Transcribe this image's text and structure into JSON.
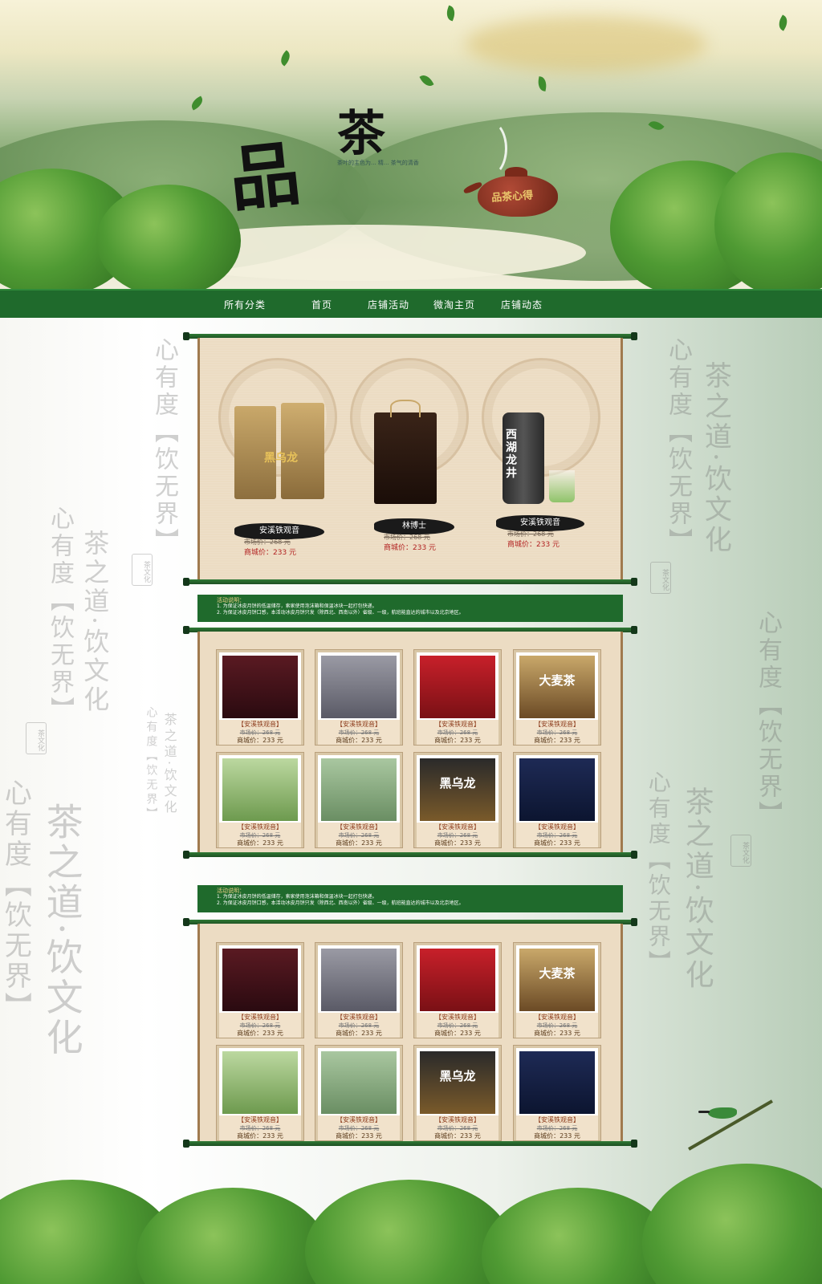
{
  "hero": {
    "logo_char_1": "品",
    "logo_char_2": "茶",
    "slogan": "茶叶的主色为... 精... 茶气的清香",
    "teapot_text": "品茶心得"
  },
  "nav": {
    "items": [
      "所有分类",
      "首页",
      "店铺活动",
      "微淘主页",
      "店铺动态"
    ]
  },
  "background_calligraphy": {
    "line_1": "心有度【饮无界】",
    "line_2": "茶之道·饮文化",
    "seal": "茶文化"
  },
  "featured": {
    "items": [
      {
        "name": "安溪铁观音",
        "market": "市场价：268 元",
        "price": "商城价：233 元",
        "img_label": "黑乌龙"
      },
      {
        "name": "林博士",
        "market": "市场价：268 元",
        "price": "商城价：233 元",
        "img_label": ""
      },
      {
        "name": "安溪铁观音",
        "market": "市场价：268 元",
        "price": "商城价：233 元",
        "img_label": "西湖龙井"
      }
    ]
  },
  "banners": [
    {
      "title": "活动说明：",
      "line1": "1. 为保证冰皮月饼的低温储存，索家使用泡沫箱和保温冰块一起打包快递。",
      "line2": "2. 为保证冰皮月饼口感，本活动冰皮月饼只发（除西北、西南以外）省级、一级，航班能直达的城市以及北京地区。"
    },
    {
      "title": "活动说明：",
      "line1": "1. 为保证冰皮月饼的低温储存，索家使用泡沫箱和保温冰块一起打包快递。",
      "line2": "2. 为保证冰皮月饼口感，本活动冰皮月饼只发（除西北、西南以外）省级、一级，航班能直达的城市以及北京地区。"
    }
  ],
  "grid1": [
    {
      "name": "【安溪铁观音】",
      "market": "市场价：268 元",
      "price": "商城价：233 元",
      "img_label": ""
    },
    {
      "name": "【安溪铁观音】",
      "market": "市场价：268 元",
      "price": "商城价：233 元",
      "img_label": ""
    },
    {
      "name": "【安溪铁观音】",
      "market": "市场价：268 元",
      "price": "商城价：233 元",
      "img_label": ""
    },
    {
      "name": "【安溪铁观音】",
      "market": "市场价：268 元",
      "price": "商城价：233 元",
      "img_label": "大麦茶"
    },
    {
      "name": "【安溪铁观音】",
      "market": "市场价：268 元",
      "price": "商城价：233 元",
      "img_label": ""
    },
    {
      "name": "【安溪铁观音】",
      "market": "市场价：268 元",
      "price": "商城价：233 元",
      "img_label": ""
    },
    {
      "name": "【安溪铁观音】",
      "market": "市场价：268 元",
      "price": "商城价：233 元",
      "img_label": "黑乌龙"
    },
    {
      "name": "【安溪铁观音】",
      "market": "市场价：268 元",
      "price": "商城价：233 元",
      "img_label": ""
    }
  ],
  "grid2": [
    {
      "name": "【安溪铁观音】",
      "market": "市场价：268 元",
      "price": "商城价：233 元",
      "img_label": ""
    },
    {
      "name": "【安溪铁观音】",
      "market": "市场价：268 元",
      "price": "商城价：233 元",
      "img_label": ""
    },
    {
      "name": "【安溪铁观音】",
      "market": "市场价：268 元",
      "price": "商城价：233 元",
      "img_label": ""
    },
    {
      "name": "【安溪铁观音】",
      "market": "市场价：268 元",
      "price": "商城价：233 元",
      "img_label": "大麦茶"
    },
    {
      "name": "【安溪铁观音】",
      "market": "市场价：268 元",
      "price": "商城价：233 元",
      "img_label": ""
    },
    {
      "name": "【安溪铁观音】",
      "market": "市场价：268 元",
      "price": "商城价：233 元",
      "img_label": ""
    },
    {
      "name": "【安溪铁观音】",
      "market": "市场价：268 元",
      "price": "商城价：233 元",
      "img_label": "黑乌龙"
    },
    {
      "name": "【安溪铁观音】",
      "market": "市场价：268 元",
      "price": "商城价：233 元",
      "img_label": ""
    }
  ],
  "colors": {
    "nav_green": "#1f6a2c",
    "parchment": "#ecdcc3",
    "price_red": "#b22222"
  }
}
